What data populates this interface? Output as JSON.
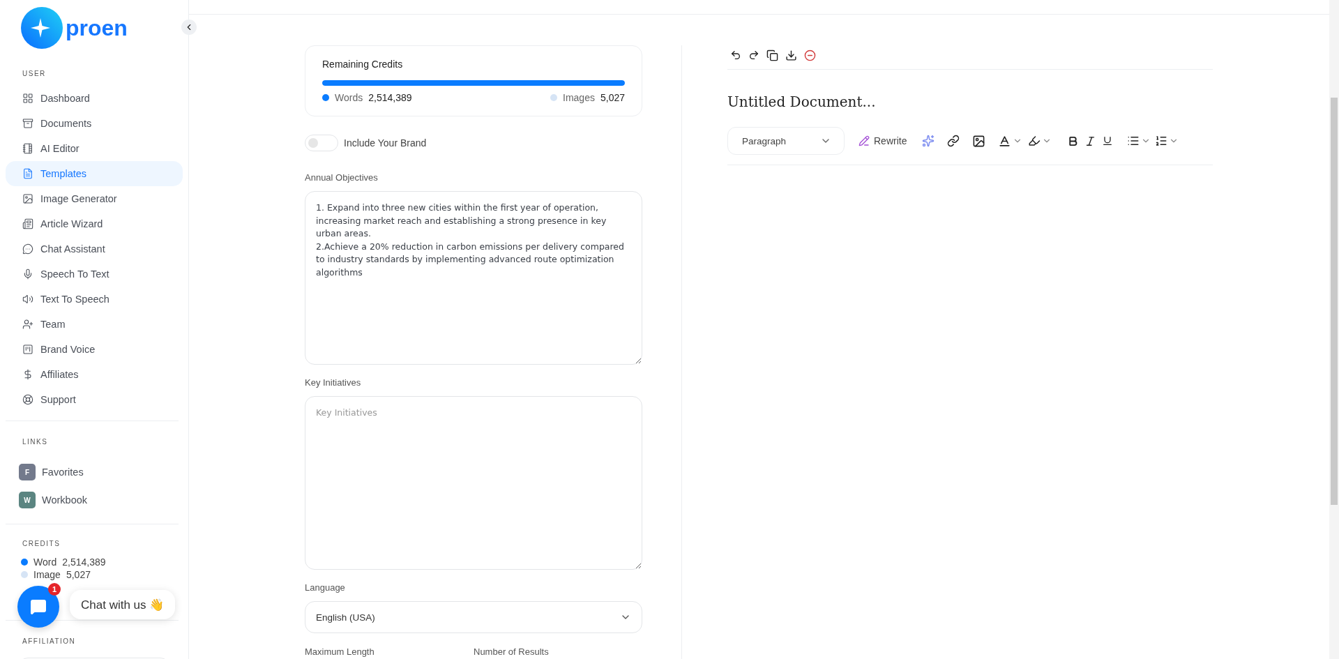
{
  "brand": {
    "name": "proen"
  },
  "sidebar": {
    "sections": [
      {
        "title": "USER",
        "items": [
          {
            "label": "Dashboard",
            "selected": false
          },
          {
            "label": "Documents",
            "selected": false
          },
          {
            "label": "AI Editor",
            "selected": false
          },
          {
            "label": "Templates",
            "selected": true
          },
          {
            "label": "Image Generator",
            "selected": false
          },
          {
            "label": "Article Wizard",
            "selected": false
          },
          {
            "label": "Chat Assistant",
            "selected": false
          },
          {
            "label": "Speech To Text",
            "selected": false
          },
          {
            "label": "Text To Speech",
            "selected": false
          },
          {
            "label": "Team",
            "selected": false
          },
          {
            "label": "Brand Voice",
            "selected": false
          },
          {
            "label": "Affiliates",
            "selected": false
          },
          {
            "label": "Support",
            "selected": false
          }
        ]
      },
      {
        "title": "LINKS",
        "links": [
          {
            "letter": "F",
            "label": "Favorites",
            "color": "#737a8c"
          },
          {
            "letter": "W",
            "label": "Workbook",
            "color": "#5b8581"
          }
        ]
      },
      {
        "title": "CREDITS",
        "credits": [
          {
            "label": "Word",
            "value": "2,514,389",
            "color": "#0a7cff"
          },
          {
            "label": "Image",
            "value": "5,027",
            "color": "#d6e4f5"
          }
        ]
      },
      {
        "title": "AFFILIATION"
      }
    ]
  },
  "chat_widget": {
    "badge": "1",
    "label": "Chat with us 👋"
  },
  "form": {
    "credits_card": {
      "title": "Remaining Credits",
      "level": 1,
      "items": [
        {
          "label": "Words",
          "value": "2,514,389",
          "color": "#0a7cff"
        },
        {
          "label": "Images",
          "value": "5,027",
          "color": "#d6e4f5"
        }
      ]
    },
    "brand_toggle": {
      "label": "Include Your Brand",
      "on": false
    },
    "fields": [
      {
        "kind": "textarea",
        "label": "Annual Objectives",
        "value": "1. Expand into three new cities within the first year of operation, increasing market reach and establishing a strong presence in key urban areas.\n2.Achieve a 20% reduction in carbon emissions per delivery compared to industry standards by implementing advanced route optimization algorithms"
      },
      {
        "kind": "textarea",
        "label": "Key Initiatives",
        "placeholder": "Key Initiatives"
      },
      {
        "kind": "select",
        "label": "Language",
        "value": "English (USA)"
      }
    ],
    "bottom_labels": [
      "Maximum Length",
      "Number of Results"
    ]
  },
  "editor": {
    "title": "Untitled Document...",
    "block_type": "Paragraph",
    "rewrite": "Rewrite"
  }
}
